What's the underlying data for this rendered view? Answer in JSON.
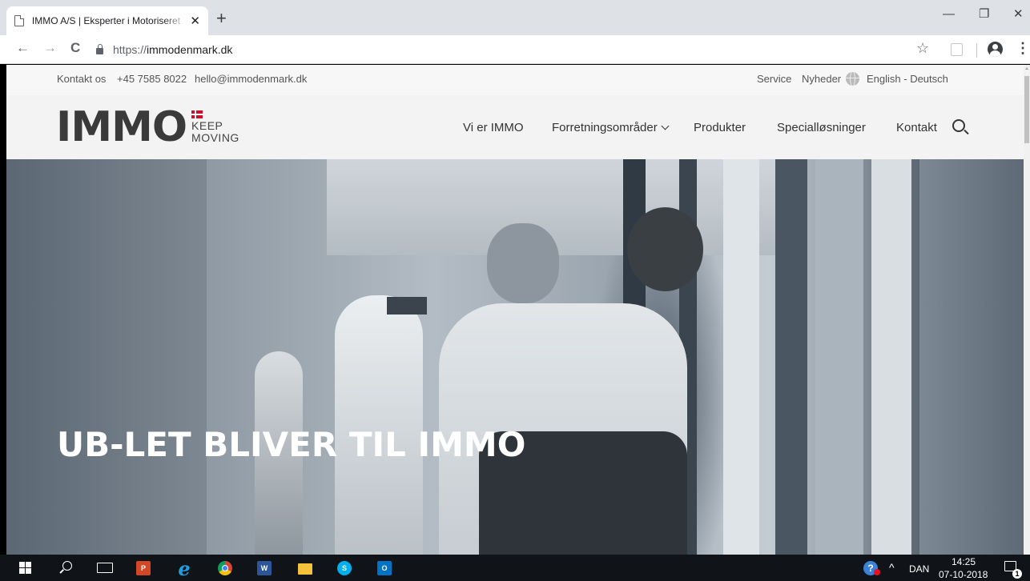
{
  "browser": {
    "tab_title": "IMMO A/S | Eksperter i Motoriseret",
    "tab_close": "✕",
    "new_tab": "+",
    "url_scheme": "https://",
    "url_host": "immodenmark.dk",
    "win_minimize": "—",
    "win_restore": "❐",
    "win_close": "✕",
    "back": "←",
    "forward": "→",
    "reload": "C",
    "bookmark_star": "☆",
    "menu": "⋮"
  },
  "topbar": {
    "contact_label": "Kontakt os",
    "phone": "+45 7585 8022",
    "email": "hello@immodenmark.dk",
    "service": "Service",
    "news": "Nyheder",
    "languages": "English - Deutsch"
  },
  "header": {
    "logo_text": "IMMO",
    "tagline_1": "KEEP",
    "tagline_2": "MOVING",
    "nav": [
      {
        "label": "Vi er IMMO"
      },
      {
        "label": "Forretningsområder"
      },
      {
        "label": "Produkter"
      },
      {
        "label": "Specialløsninger"
      },
      {
        "label": "Kontakt"
      }
    ]
  },
  "hero": {
    "headline": "UB-LET BLIVER TIL IMMO"
  },
  "taskbar": {
    "apps": [
      {
        "name": "powerpoint",
        "glyph": "P"
      },
      {
        "name": "internet-explorer",
        "glyph": "e"
      },
      {
        "name": "chrome",
        "glyph": ""
      },
      {
        "name": "word",
        "glyph": "W"
      },
      {
        "name": "file-explorer",
        "glyph": ""
      },
      {
        "name": "skype",
        "glyph": "S"
      },
      {
        "name": "outlook",
        "glyph": "O"
      }
    ],
    "tray_caret": "^",
    "language": "DAN",
    "time": "14:25",
    "date": "07-10-2018",
    "notification_count": "1"
  },
  "colors": {
    "chrome_tabbar": "#dee1e6",
    "site_bg": "#f7f7f7",
    "header_bg": "#f3f3f3",
    "logo_text": "#3a3a3a",
    "flag_red": "#c8102e",
    "taskbar": "#101418"
  }
}
